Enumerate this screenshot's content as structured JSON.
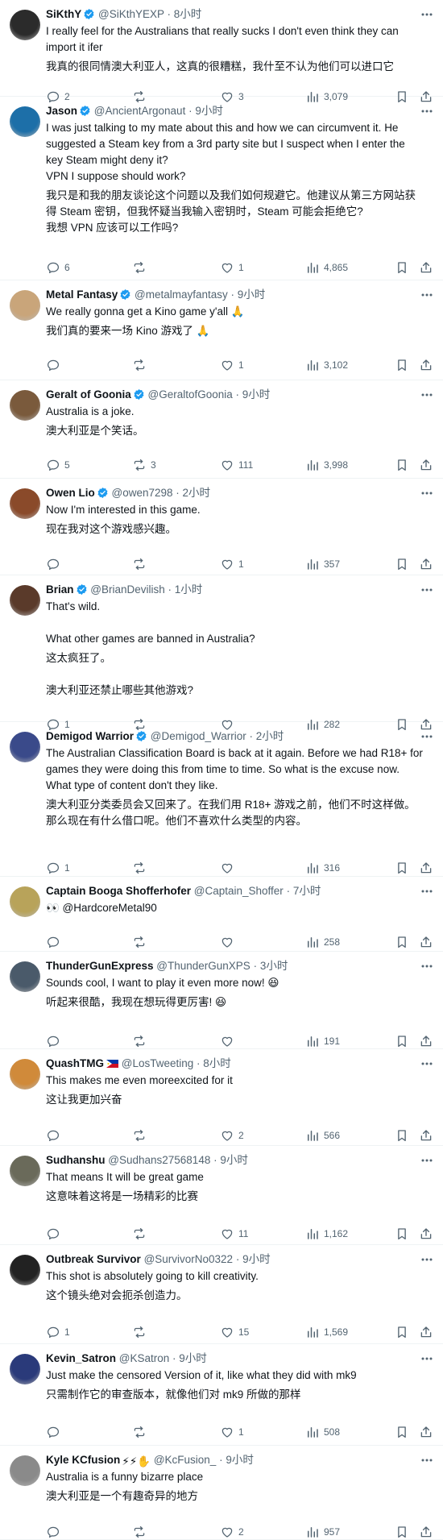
{
  "tweets": [
    {
      "name": "SiKthY",
      "handle": "@SiKthYEXP",
      "time": "8小时",
      "verified": true,
      "text": "I really feel for the Australians that really sucks I don't even think they can import it ifer",
      "translation": "我真的很同情澳大利亚人，这真的很糟糕，我什至不认为他们可以进口它",
      "replies": "2",
      "retweets": "",
      "likes": "3",
      "views": "3,079",
      "avatar_color": "#2b2b2b"
    },
    {
      "name": "Jason",
      "handle": "@AncientArgonaut",
      "time": "9小时",
      "verified": true,
      "text": "I was just talking to my mate about this and how we can circumvent it. He suggested a Steam key from a 3rd party site but I suspect when I enter the key Steam might deny it?\nVPN I suppose should work?",
      "translation": "我只是和我的朋友谈论这个问题以及我们如何规避它。他建议从第三方网站获得 Steam 密钥，但我怀疑当我输入密钥时，Steam 可能会拒绝它?\n我想 VPN 应该可以工作吗?",
      "replies": "6",
      "retweets": "",
      "likes": "1",
      "views": "4,865",
      "avatar_color": "#1d6fa8"
    },
    {
      "name": "Metal Fantasy",
      "handle": "@metalmayfantasy",
      "time": "9小时",
      "verified": true,
      "text": "We really gonna get a Kino game y'all 🙏",
      "translation": "我们真的要来一场 Kino 游戏了 🙏",
      "replies": "",
      "retweets": "",
      "likes": "1",
      "views": "3,102",
      "avatar_color": "#c9a57a"
    },
    {
      "name": "Geralt of Goonia",
      "handle": "@GeraltofGoonia",
      "time": "9小时",
      "verified": true,
      "text": "Australia is a joke.",
      "translation": "澳大利亚是个笑话。",
      "replies": "5",
      "retweets": "3",
      "likes": "111",
      "views": "3,998",
      "avatar_color": "#7a5a3c"
    },
    {
      "name": "Owen Lio",
      "handle": "@owen7298",
      "time": "2小时",
      "verified": true,
      "text": "Now I'm interested in this game.",
      "translation": "现在我对这个游戏感兴趣。",
      "replies": "",
      "retweets": "",
      "likes": "1",
      "views": "357",
      "avatar_color": "#8a4a2a"
    },
    {
      "name": "Brian",
      "handle": "@BrianDevilish",
      "time": "1小时",
      "verified": true,
      "text": "That's wild.\n\nWhat other games are banned in Australia?",
      "translation": "这太疯狂了。\n\n澳大利亚还禁止哪些其他游戏?",
      "replies": "1",
      "retweets": "",
      "likes": "",
      "views": "282",
      "avatar_color": "#5a3a2a"
    },
    {
      "name": "Demigod Warrior",
      "handle": "@Demigod_Warrior",
      "time": "2小时",
      "verified": true,
      "text": "The Australian Classification Board is back at it again. Before we had R18+ for games they were doing this from time to time. So what is the excuse now. What type of content don't they like.",
      "translation": "澳大利亚分类委员会又回来了。在我们用 R18+ 游戏之前，他们不时这样做。那么现在有什么借口呢。他们不喜欢什么类型的内容。",
      "replies": "1",
      "retweets": "",
      "likes": "",
      "views": "316",
      "avatar_color": "#3a4a8a"
    },
    {
      "name": "Captain Booga Shofferhofer",
      "handle": "@Captain_Shoffer",
      "time": "7小时",
      "verified": false,
      "text": "👀 @HardcoreMetal90",
      "translation": "",
      "replies": "",
      "retweets": "",
      "likes": "",
      "views": "258",
      "avatar_color": "#b8a35a"
    },
    {
      "name": "ThunderGunExpress",
      "handle": "@ThunderGunXPS",
      "time": "3小时",
      "verified": false,
      "text": "Sounds cool, I want to play it even more now! 😆",
      "translation": "听起来很酷，我现在想玩得更厉害! 😆",
      "replies": "",
      "retweets": "",
      "likes": "",
      "views": "191",
      "avatar_color": "#4a5a6a"
    },
    {
      "name": "QuashTMG",
      "handle": "@LosTweeting",
      "time": "8小时",
      "verified": false,
      "flag": true,
      "text": "This makes me even moreexcited for it",
      "translation": "这让我更加兴奋",
      "replies": "",
      "retweets": "",
      "likes": "2",
      "views": "566",
      "avatar_color": "#d08a3a"
    },
    {
      "name": "Sudhanshu",
      "handle": "@Sudhans27568148",
      "time": "9小时",
      "verified": false,
      "text": "That means It will be great game",
      "translation": "这意味着这将是一场精彩的比赛",
      "replies": "",
      "retweets": "",
      "likes": "11",
      "views": "1,162",
      "avatar_color": "#6a6a5a"
    },
    {
      "name": "Outbreak Survivor",
      "handle": "@SurvivorNo0322",
      "time": "9小时",
      "verified": false,
      "text": "This shot is absolutely going to kill creativity.",
      "translation": "这个镜头绝对会扼杀创造力。",
      "replies": "1",
      "retweets": "",
      "likes": "15",
      "views": "1,569",
      "avatar_color": "#222222"
    },
    {
      "name": "Kevin_Satron",
      "handle": "@KSatron",
      "time": "9小时",
      "verified": false,
      "text": "Just make the censored Version of it, like what they did with mk9",
      "translation": "只需制作它的审查版本，就像他们对 mk9 所做的那样",
      "replies": "",
      "retweets": "",
      "likes": "1",
      "views": "508",
      "avatar_color": "#2a3a7a"
    },
    {
      "name": "Kyle KCfusion",
      "handle": "@KcFusion_",
      "time": "9小时",
      "verified": false,
      "emoji": "⚡⚡✋",
      "text": "Australia is a funny bizarre place",
      "translation": "澳大利亚是一个有趣奇异的地方",
      "replies": "",
      "retweets": "",
      "likes": "2",
      "views": "957",
      "avatar_color": "#8a8a8a"
    }
  ]
}
